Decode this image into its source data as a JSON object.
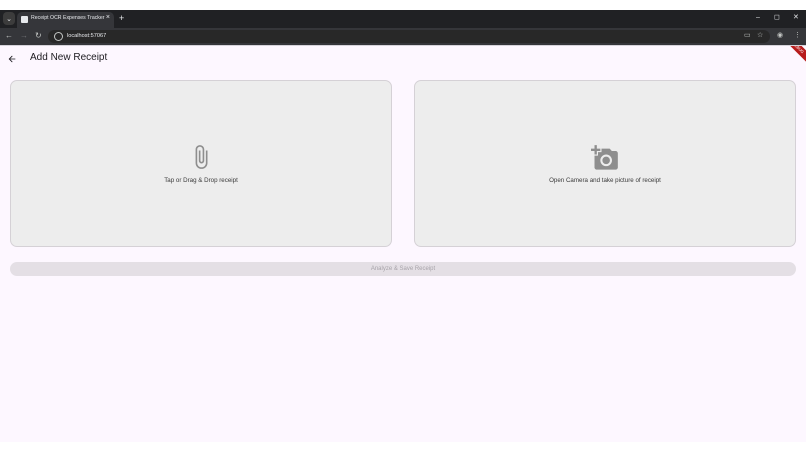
{
  "browser": {
    "tab_title": "Receipt OCR Expenses Tracker",
    "tab_close": "×",
    "new_tab": "+",
    "url": "localhost:57067",
    "window_controls": {
      "minimize": "–",
      "maximize": "◻",
      "close": "✕"
    }
  },
  "app": {
    "page_title": "Add New Receipt",
    "debug_banner": "DEBUG",
    "upload_card": {
      "label": "Tap or Drag & Drop receipt",
      "icon": "paperclip-icon"
    },
    "camera_card": {
      "label": "Open Camera and take picture of receipt",
      "icon": "add-camera-icon"
    },
    "analyze_button": {
      "label": "Analyze & Save Receipt",
      "state": "disabled"
    },
    "colors": {
      "background": "#fdf7ff",
      "card": "#ededed",
      "card_border": "#d5d1d6",
      "icon": "#8e8e8e",
      "disabled_button": "#e4dfe5",
      "debug_banner": "#b71c1c"
    }
  }
}
